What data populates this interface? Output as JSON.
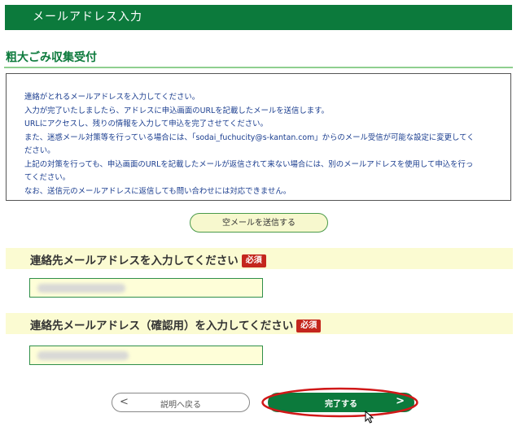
{
  "header": {
    "title": "メールアドレス入力"
  },
  "section": {
    "title": "粗大ごみ収集受付"
  },
  "notice": {
    "lines": [
      "連絡がとれるメールアドレスを入力してください。",
      "入力が完了いたしましたら、アドレスに申込画面のURLを記載したメールを送信します。",
      "URLにアクセスし、残りの情報を入力して申込を完了させてください。",
      "また、迷惑メール対策等を行っている場合には、「sodai_fuchucity@s-kantan.com」からのメール受信が可能な設定に変更してく",
      "ださい。",
      "上記の対策を行っても、申込画面のURLを記載したメールが返信されて来ない場合には、別のメールアドレスを使用して申込を行っ",
      "てください。",
      "なお、送信元のメールアドレスに返信しても問い合わせには対応できません。"
    ]
  },
  "send_empty_mail": {
    "label": "空メールを送信する"
  },
  "email_field": {
    "label": "連絡先メールアドレスを入力してください",
    "required": "必須",
    "value": ""
  },
  "confirm_field": {
    "label": "連絡先メールアドレス（確認用）を入力してください",
    "required": "必須",
    "value": ""
  },
  "buttons": {
    "back": {
      "label": "説明へ戻る",
      "icon": "chevron-left-icon"
    },
    "complete": {
      "label": "完了する",
      "icon": "chevron-right-icon"
    }
  },
  "colors": {
    "brand_green": "#0c7a3c",
    "notice_text": "#1a3d8f",
    "required_badge": "#c4261d",
    "label_band": "#fbfbd2",
    "highlight_ring": "#d01818"
  }
}
